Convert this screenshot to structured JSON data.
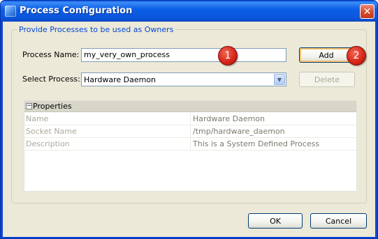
{
  "window": {
    "title": "Process Configuration",
    "close_glyph": "✕",
    "icon": "app-icon"
  },
  "group": {
    "legend": "Provide Processes to be used as Owners"
  },
  "form": {
    "process_name_label": "Process Name:",
    "process_name_value": "my_very_own_process",
    "select_process_label": "Select Process:",
    "select_process_value": "Hardware Daemon",
    "dropdown_icon": "chevron-down-icon"
  },
  "buttons": {
    "add": "Add",
    "delete": "Delete",
    "ok": "OK",
    "cancel": "Cancel"
  },
  "markers": {
    "one": "1",
    "two": "2"
  },
  "properties": {
    "expander": "−",
    "title": "Properties",
    "rows": [
      {
        "name": "Name",
        "value": "Hardware Daemon"
      },
      {
        "name": "Socket Name",
        "value": "/tmp/hardware_daemon"
      },
      {
        "name": "Description",
        "value": "This is a System Defined Process"
      }
    ]
  },
  "colors": {
    "titlebar": "#0a55dc",
    "legend_text": "#0046d5",
    "marker": "#d8271a",
    "dialog_bg": "#ece9d8"
  }
}
